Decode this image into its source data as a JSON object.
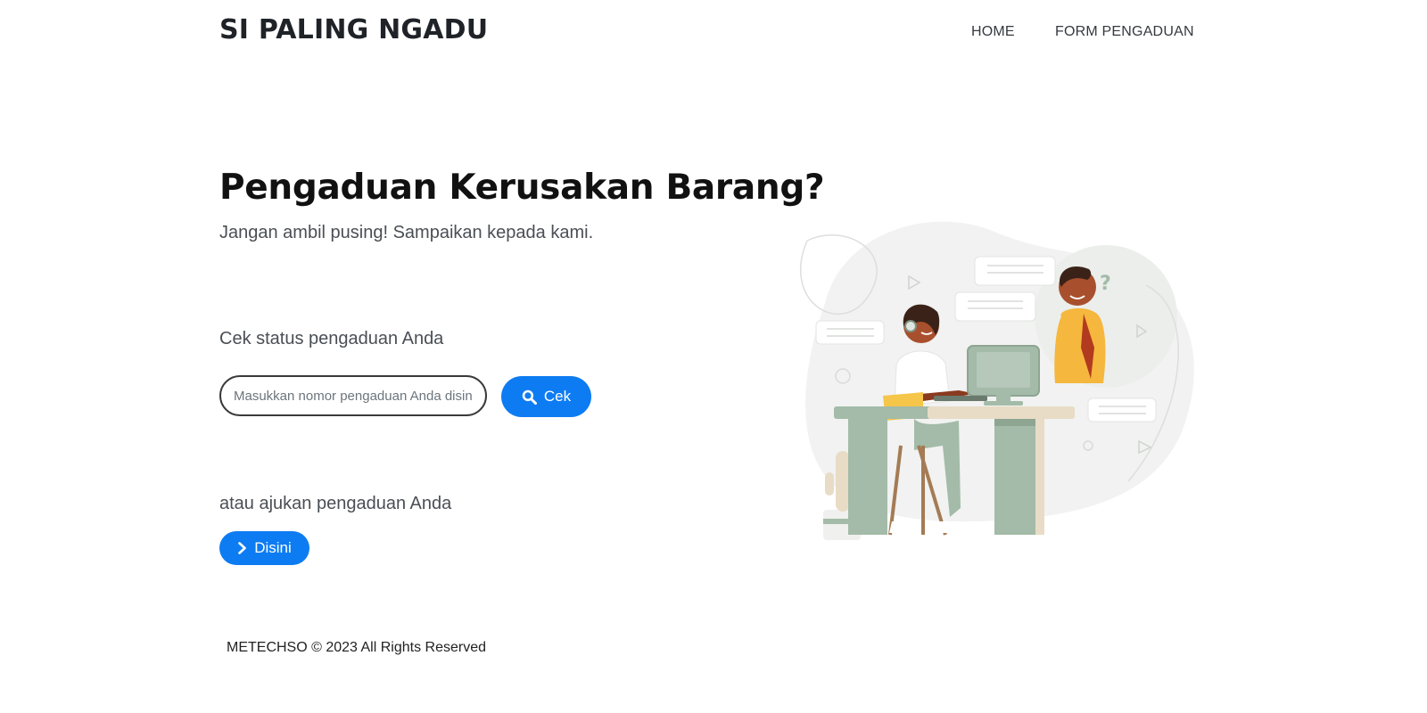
{
  "header": {
    "brand": "SI PALING NGADU",
    "nav": [
      {
        "label": "HOME"
      },
      {
        "label": "FORM PENGADUAN"
      }
    ]
  },
  "hero": {
    "title": "Pengaduan Kerusakan Barang?",
    "subtitle": "Jangan ambil pusing! Sampaikan kepada kami."
  },
  "status_check": {
    "label": "Cek status pengaduan Anda",
    "input_placeholder": "Masukkan nomor pengaduan Anda disini",
    "input_value": "",
    "button_label": "Cek",
    "button_icon": "search-icon"
  },
  "submit": {
    "label": "atau ajukan pengaduan Anda",
    "button_label": "Disini",
    "button_icon": "chevron-right-icon"
  },
  "footer": {
    "text": "METECHSO © 2023 All Rights Reserved"
  },
  "colors": {
    "primary": "#0d7cf2",
    "illustration_green": "#a3bba8",
    "illustration_blob": "#f1f2f1"
  }
}
